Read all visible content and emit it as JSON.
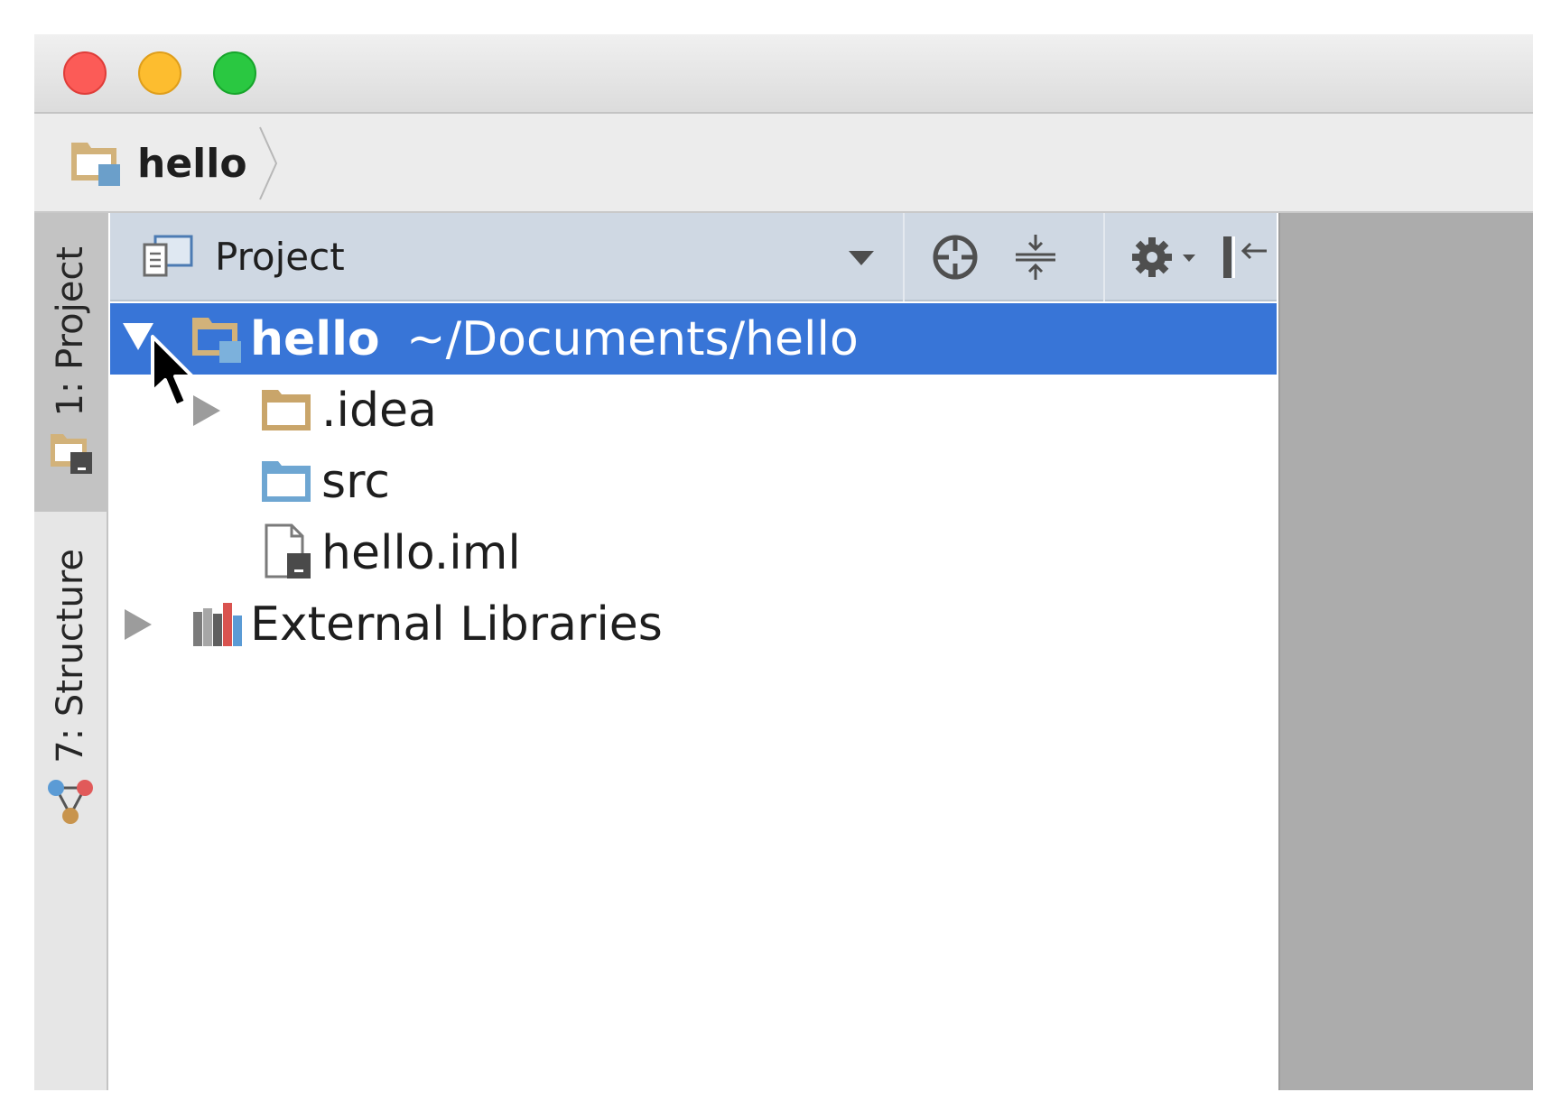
{
  "window": {
    "traffic_lights": [
      {
        "name": "close",
        "color": "#fc5b57"
      },
      {
        "name": "minimize",
        "color": "#fdbd2f"
      },
      {
        "name": "zoom",
        "color": "#2ac841"
      }
    ]
  },
  "navbar": {
    "crumb_label": "hello",
    "crumb_icon": "project-folder-icon"
  },
  "sidebar": {
    "tabs": [
      {
        "label": "1: Project",
        "active": true,
        "icon": "project-folder-icon"
      },
      {
        "label": "7: Structure",
        "active": false,
        "icon": "structure-icon"
      }
    ]
  },
  "project_panel": {
    "view_label": "Project",
    "toolbar_icons": [
      "scroll-from-source-icon",
      "collapse-all-icon",
      "gear-icon",
      "hide-icon"
    ],
    "tree": {
      "root_name": "hello",
      "root_path": "~/Documents/hello",
      "children": [
        {
          "label": ".idea",
          "icon": "folder-icon",
          "expandable": true
        },
        {
          "label": "src",
          "icon": "source-folder-icon",
          "expandable": false
        },
        {
          "label": "hello.iml",
          "icon": "iml-file-icon",
          "expandable": false
        }
      ],
      "external": {
        "label": "External Libraries",
        "icon": "libraries-icon",
        "expandable": true
      }
    },
    "selection_color": "#3875d7",
    "header_color": "#cfd8e3"
  }
}
